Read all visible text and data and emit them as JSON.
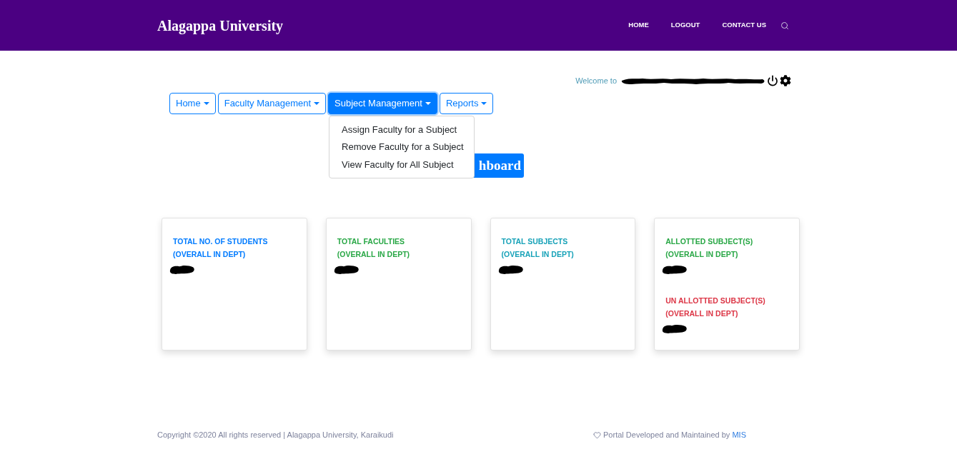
{
  "header": {
    "title": "Alagappa University",
    "nav": [
      "HOME",
      "LOGOUT",
      "CONTACT US"
    ]
  },
  "welcome": {
    "text": "Welcome to"
  },
  "menus": [
    {
      "label": "Home",
      "expanded": false
    },
    {
      "label": "Faculty Management",
      "expanded": false
    },
    {
      "label": "Subject Management",
      "expanded": true,
      "items": [
        "Assign Faculty for a Subject",
        "Remove Faculty for a Subject",
        "View Faculty for All Subject"
      ]
    },
    {
      "label": "Reports",
      "expanded": false
    }
  ],
  "dashboard_button": {
    "label": "hboard"
  },
  "cards": [
    {
      "stats": [
        {
          "title": "TOTAL NO. OF STUDENTS",
          "note": "(OVERALL IN DEPT)",
          "color": "#007bff"
        }
      ]
    },
    {
      "stats": [
        {
          "title": "TOTAL FACULTIES",
          "note": "(OVERALL IN DEPT)",
          "color": "#28a745"
        }
      ]
    },
    {
      "stats": [
        {
          "title": "TOTAL SUBJECTS",
          "note": "(OVERALL IN DEPT)",
          "color": "#17a2b8"
        }
      ]
    },
    {
      "stats": [
        {
          "title": "ALLOTTED SUBJECT(S)",
          "note": "(OVERALL IN DEPT)",
          "color": "#28a745"
        },
        {
          "title": "UN ALLOTTED SUBJECT(S)",
          "note": "(OVERALL IN DEPT)",
          "color": "#dc3545"
        }
      ]
    }
  ],
  "footer": {
    "copyright": "Copyright ©2020 All rights reserved | Alagappa University, Karaikudi",
    "credit": "Portal Developed and Maintained by",
    "credit_link": "MIS"
  }
}
